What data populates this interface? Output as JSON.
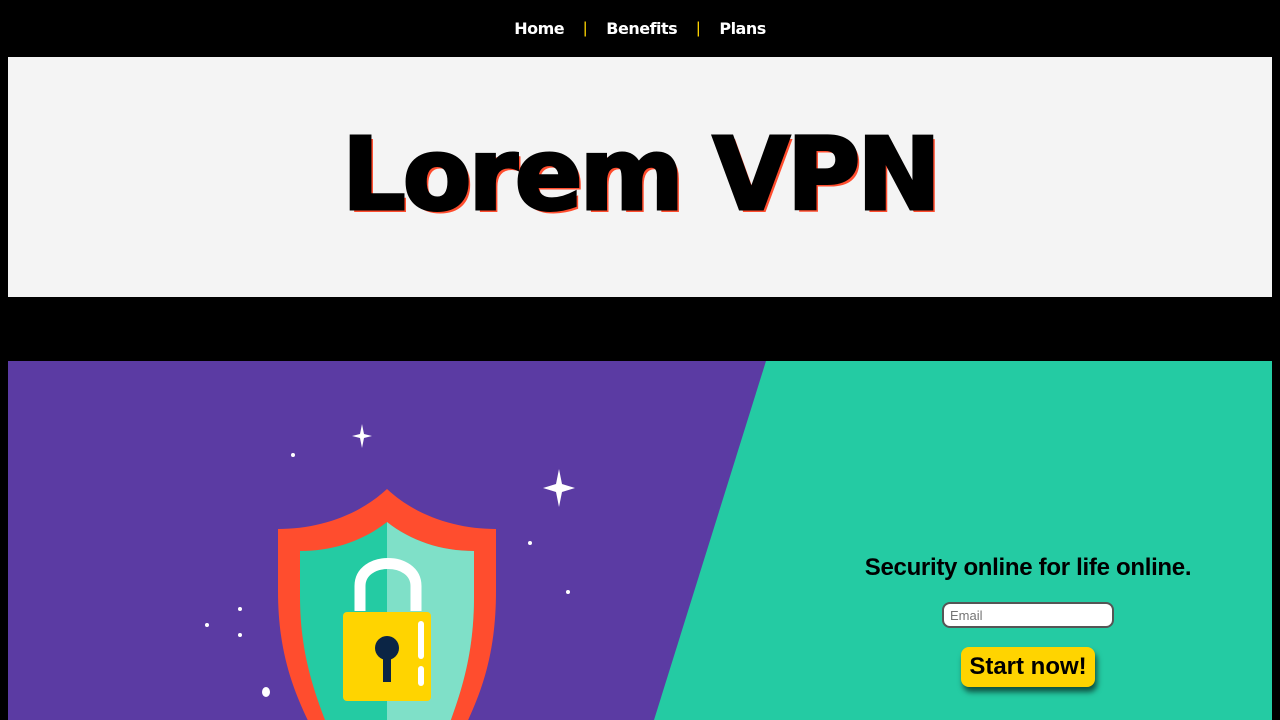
{
  "nav": {
    "items": [
      {
        "label": "Home"
      },
      {
        "label": "Benefits"
      },
      {
        "label": "Plans"
      }
    ],
    "separator": "|"
  },
  "hero": {
    "title": "Lorem VPN"
  },
  "cta": {
    "headline": "Security online for life online.",
    "email_placeholder": "Email",
    "button_label": "Start now!"
  },
  "colors": {
    "purple": "#5b3ba3",
    "green": "#24cba3",
    "accent": "#ffd400",
    "red": "#ff4d2e"
  }
}
